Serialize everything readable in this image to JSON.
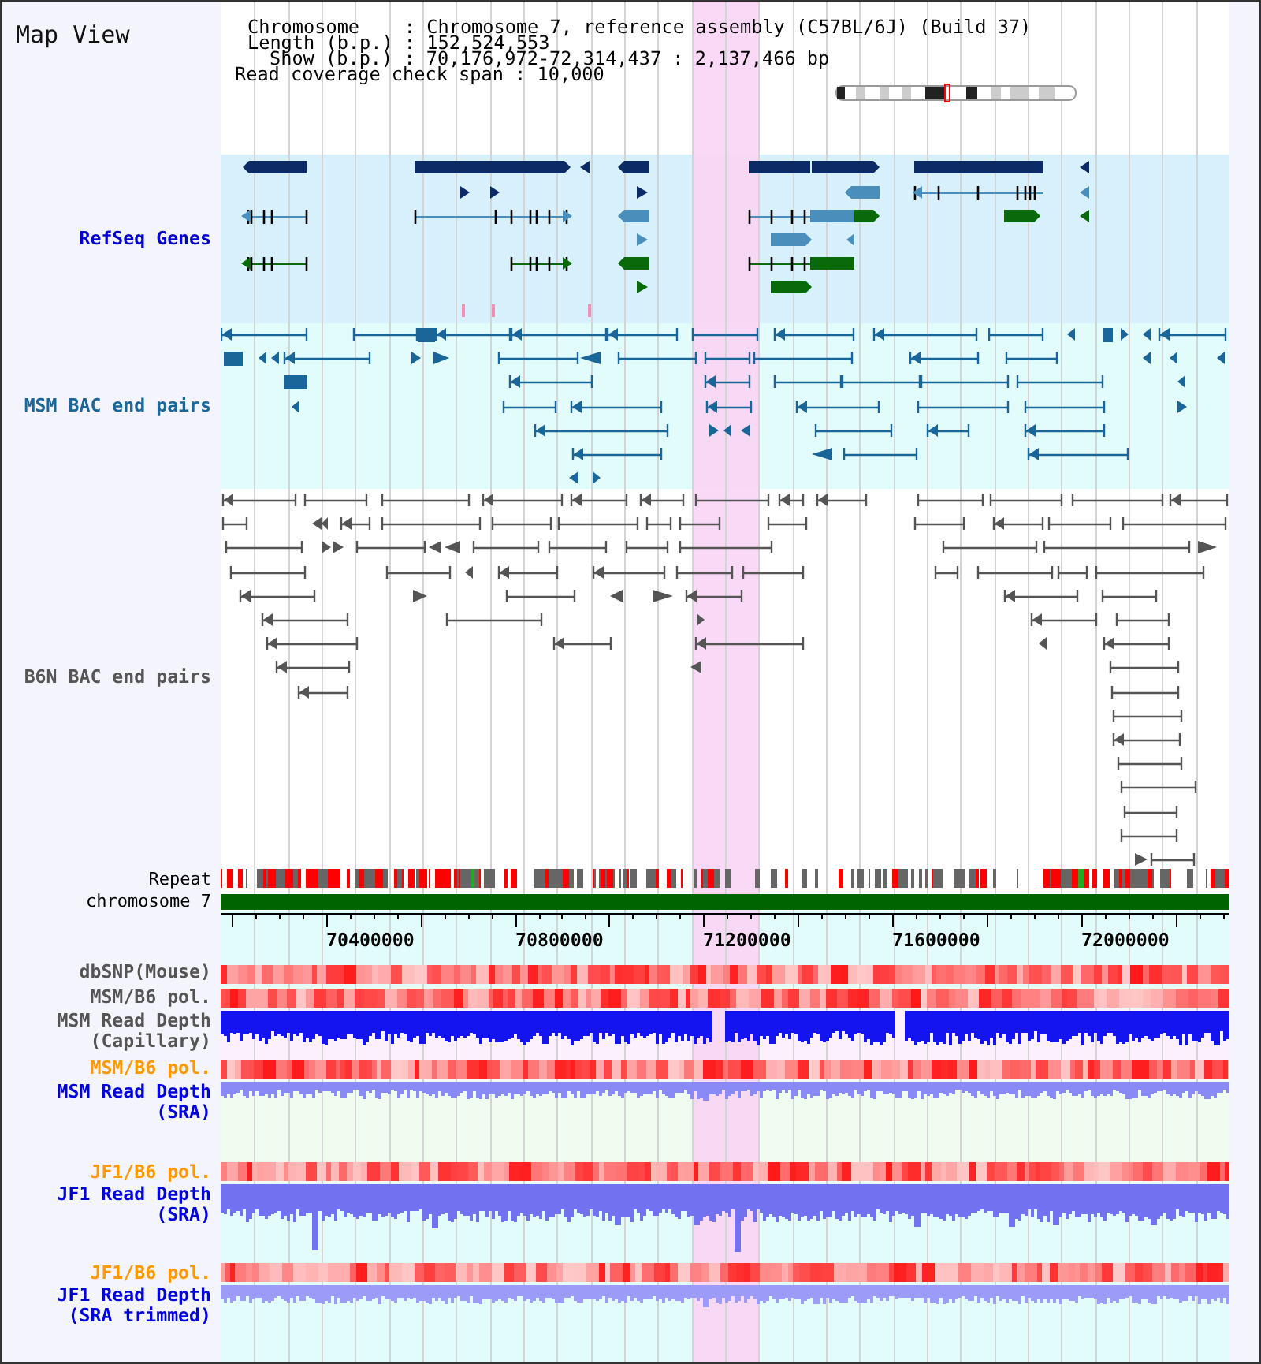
{
  "view_title": "Map View",
  "header": {
    "lines": [
      "Chromosome    : Chromosome 7, reference assembly (C57BL/6J) (Build 37)",
      "Length (b.p.) : 152,524,553",
      "Show (b.p.) : 70,176,972-72,314,437 : 2,137,466 bp",
      "Read coverage check span : 10,000"
    ]
  },
  "tracks": [
    {
      "kind": "genes",
      "label": "RefSeq Genes",
      "color": "#0000cc"
    },
    {
      "kind": "bac",
      "label": "MSM BAC end pairs",
      "color": "#1a6699"
    },
    {
      "kind": "bac",
      "label": "B6N BAC end pairs",
      "color": "#555555"
    },
    {
      "kind": "repeat",
      "label": "Repeat",
      "color": "#000000"
    },
    {
      "kind": "chromosome",
      "label": "chromosome 7",
      "color": "#000000"
    },
    {
      "kind": "ruler",
      "tick_labels": [
        "70400000",
        "70800000",
        "71200000",
        "71600000",
        "72000000"
      ]
    },
    {
      "kind": "heatmap",
      "label": "dbSNP(Mouse)",
      "color": "#555555"
    },
    {
      "kind": "heatmap",
      "label": "MSM/B6 pol.",
      "color": "#555555"
    },
    {
      "kind": "depth",
      "label": "MSM Read Depth",
      "sublabel": "(Capillary)",
      "color": "#555555"
    },
    {
      "kind": "heatmap",
      "label": "MSM/B6 pol.",
      "color": "#ff9900"
    },
    {
      "kind": "depth",
      "label": "MSM Read Depth",
      "sublabel": "(SRA)",
      "color": "#0000dd"
    },
    {
      "kind": "heatmap",
      "label": "JF1/B6 pol.",
      "color": "#ff9900"
    },
    {
      "kind": "depth",
      "label": "JF1 Read Depth",
      "sublabel": "(SRA)",
      "color": "#0000dd"
    },
    {
      "kind": "heatmap",
      "label": "JF1/B6 pol.",
      "color": "#ff9900"
    },
    {
      "kind": "depth",
      "label": "JF1 Read Depth",
      "sublabel": "(SRA trimmed)",
      "color": "#0000dd"
    }
  ]
}
